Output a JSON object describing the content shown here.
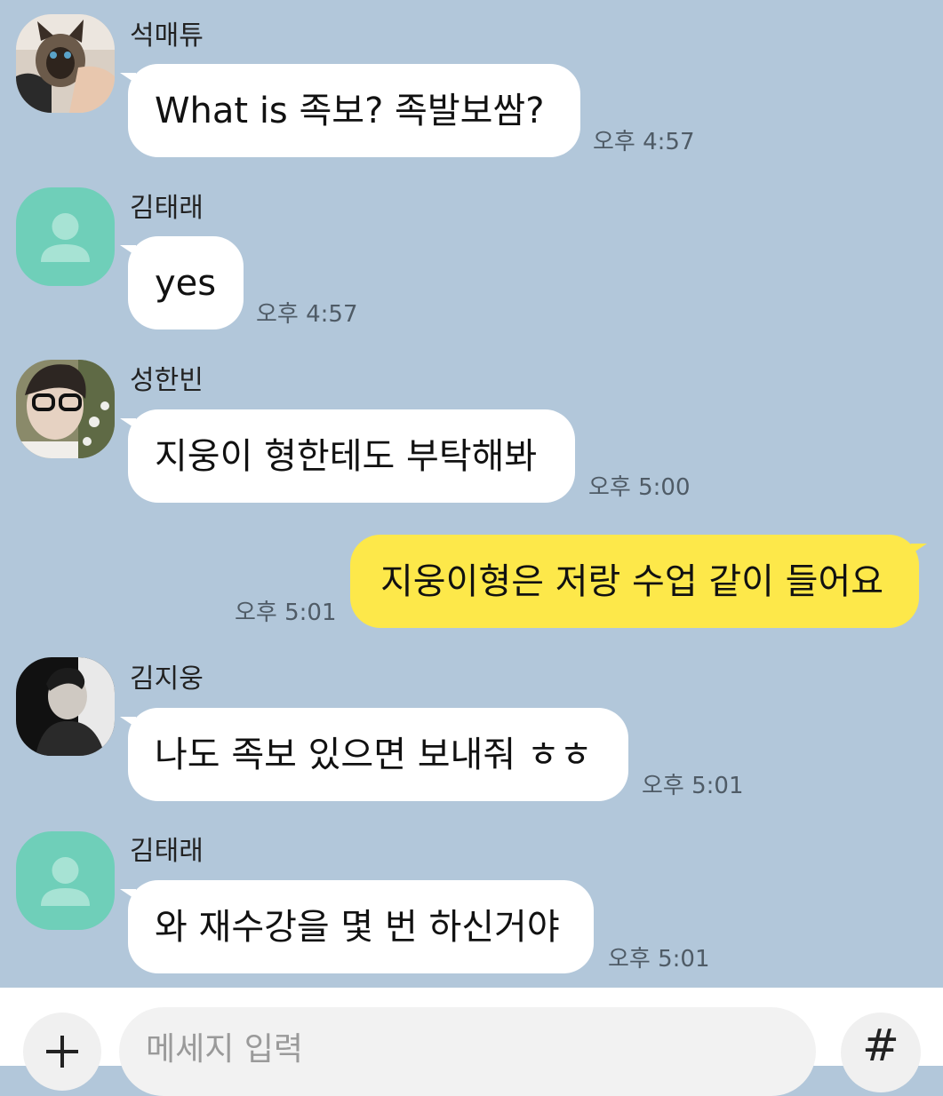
{
  "messages": [
    {
      "sender": "석매튜",
      "text": "What is 족보? 족발보쌈?",
      "time": "오후 4:57",
      "direction": "incoming",
      "avatar": "cat-photo"
    },
    {
      "sender": "김태래",
      "text": "yes",
      "time": "오후 4:57",
      "direction": "incoming",
      "avatar": "default-profile"
    },
    {
      "sender": "성한빈",
      "text": "지웅이 형한테도 부탁해봐",
      "time": "오후 5:00",
      "direction": "incoming",
      "avatar": "person-photo"
    },
    {
      "text": "지웅이형은 저랑 수업 같이 들어요",
      "time": "오후 5:01",
      "direction": "outgoing"
    },
    {
      "sender": "김지웅",
      "text": "나도 족보 있으면 보내줘 ㅎㅎ",
      "time": "오후 5:01",
      "direction": "incoming",
      "avatar": "person-photo-dark"
    },
    {
      "sender": "김태래",
      "text": "와 재수강을 몇 번 하신거야",
      "time": "오후 5:01",
      "direction": "incoming",
      "avatar": "default-profile"
    }
  ],
  "composer": {
    "placeholder": "메세지 입력",
    "plus_icon": "plus-icon",
    "emoji_icon": "emoji-icon",
    "hash_label": "#"
  },
  "colors": {
    "background": "#b2c7da",
    "incoming_bubble": "#ffffff",
    "outgoing_bubble": "#fde84a",
    "default_avatar": "#6fcfb9"
  }
}
